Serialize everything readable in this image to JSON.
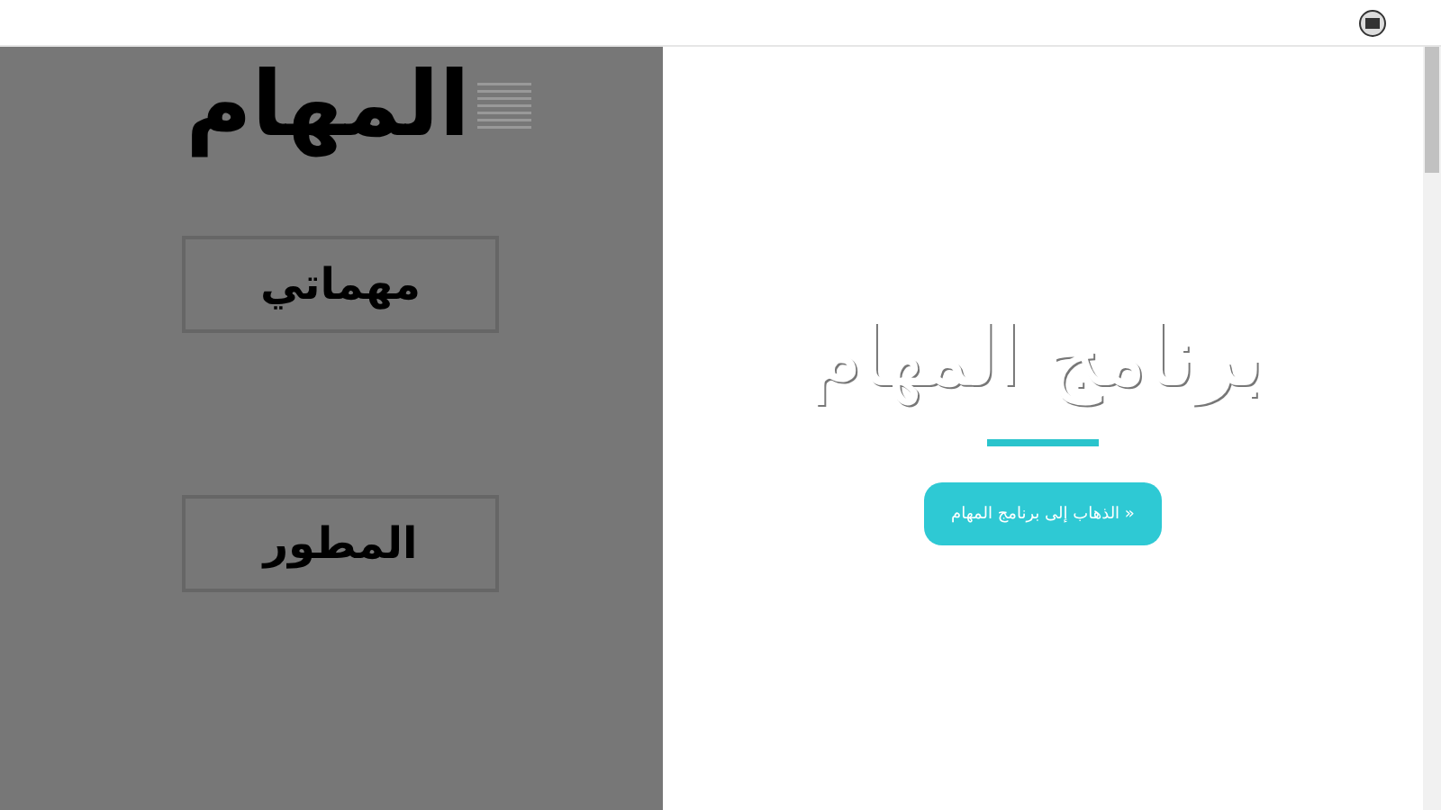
{
  "sidebar": {
    "title": "المهام",
    "buttons": [
      {
        "label": "مهماتي"
      },
      {
        "label": "المطور"
      }
    ]
  },
  "hero": {
    "title": "برنامج المهام",
    "button": "« الذهاب إلى برنامج المهام"
  }
}
